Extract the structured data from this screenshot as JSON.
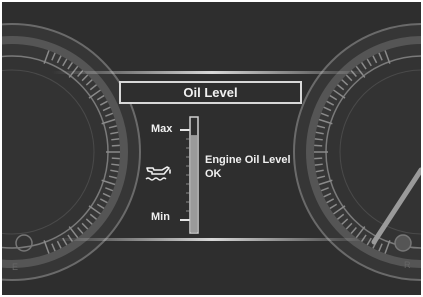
{
  "title": "Oil Level",
  "scale": {
    "max_label": "Max",
    "min_label": "Min"
  },
  "oil_level_fraction": 0.85,
  "status": {
    "line1": "Engine Oil Level",
    "line2": "OK"
  },
  "icons": {
    "oil": "oil-can-icon"
  },
  "colors": {
    "background": "#2e2e2e",
    "text": "#f0f0f0",
    "fill": "#9a9a9a"
  }
}
